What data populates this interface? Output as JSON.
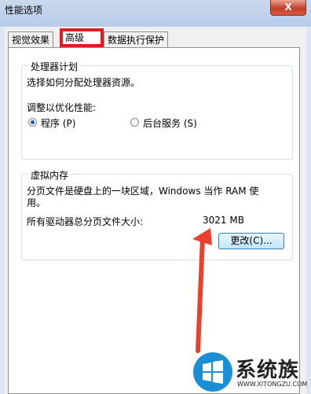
{
  "window": {
    "title": "性能选项",
    "close_label": "X"
  },
  "tabs": [
    {
      "label": "视觉效果",
      "active": false
    },
    {
      "label": "高级",
      "active": true
    },
    {
      "label": "数据执行保护",
      "active": false
    }
  ],
  "processor": {
    "title": "处理器计划",
    "description": "选择如何分配处理器资源。",
    "adjust_label": "调整以优化性能:",
    "options": [
      {
        "label": "程序 (P)",
        "selected": true
      },
      {
        "label": "后台服务 (S)",
        "selected": false
      }
    ]
  },
  "virtual_memory": {
    "title": "虚拟内存",
    "description_line1": "分页文件是硬盘上的一块区域，Windows 当作 RAM 使",
    "description_line2": "用。",
    "total_label": "所有驱动器总分页文件大小:",
    "total_value": "3021 MB",
    "change_button": "更改(C)..."
  },
  "watermark": {
    "brand": "系统族",
    "url": "WWW.XITONGZU.COM"
  },
  "colors": {
    "highlight": "#e31c23",
    "arrow": "#e8412e",
    "logo_blue": "#1a8fd6"
  }
}
